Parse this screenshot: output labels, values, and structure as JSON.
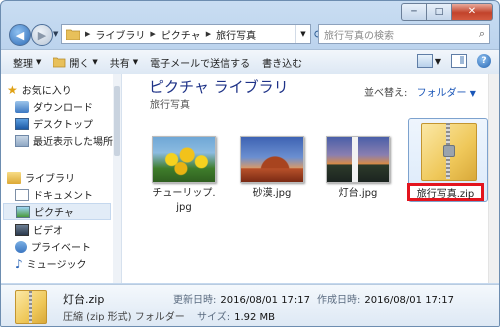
{
  "window": {
    "minimize": "─",
    "maximize": "□",
    "close": "✕"
  },
  "address": {
    "crumbs": [
      "ライブラリ",
      "ピクチャ",
      "旅行写真"
    ],
    "search_placeholder": "旅行写真の検索"
  },
  "toolbar": {
    "organize": "整理",
    "open": "開く",
    "share": "共有",
    "email": "電子メールで送信する",
    "burn": "書き込む"
  },
  "nav": {
    "favorites": "お気に入り",
    "downloads": "ダウンロード",
    "desktop": "デスクトップ",
    "recent": "最近表示した場所",
    "libraries": "ライブラリ",
    "documents": "ドキュメント",
    "pictures": "ピクチャ",
    "videos": "ビデオ",
    "private": "プライベート",
    "music": "ミュージック"
  },
  "content": {
    "title": "ピクチャ ライブラリ",
    "subtitle": "旅行写真",
    "arrange_label": "並べ替え:",
    "arrange_value": "フォルダー",
    "items": [
      {
        "label_line1": "チューリップ.",
        "label_line2": "jpg"
      },
      {
        "label_line1": "砂漠.jpg",
        "label_line2": ""
      },
      {
        "label_line1": "灯台.jpg",
        "label_line2": ""
      },
      {
        "label_line1": "旅行写真.zip",
        "label_line2": ""
      }
    ]
  },
  "details": {
    "name": "灯台.zip",
    "type": "圧縮 (zip 形式) フォルダー",
    "modified_label": "更新日時:",
    "modified_value": "2016/08/01 17:17",
    "created_label": "作成日時:",
    "created_value": "2016/08/01 17:17",
    "size_label": "サイズ:",
    "size_value": "1.92 MB"
  }
}
